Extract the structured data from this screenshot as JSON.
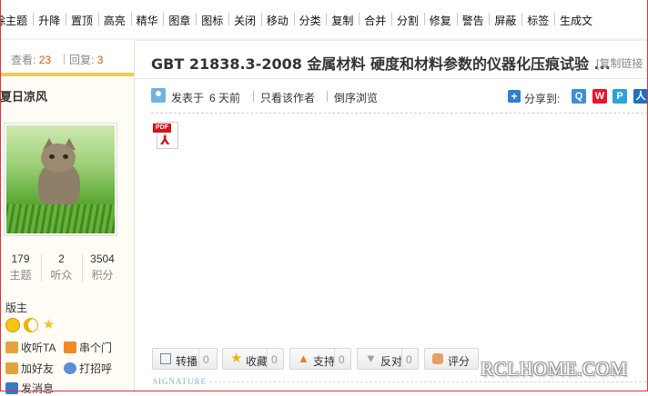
{
  "toolbar": {
    "items": [
      "除主题",
      "升降",
      "置顶",
      "高亮",
      "精华",
      "图章",
      "图标",
      "关闭",
      "移动",
      "分类",
      "复制",
      "合并",
      "分割",
      "修复",
      "警告",
      "屏蔽",
      "标签",
      "生成文"
    ]
  },
  "sidebar": {
    "views_label": "查看:",
    "views_count": "23",
    "replies_label": "回复:",
    "replies_count": "3",
    "username": "夏日凉风",
    "stats": [
      {
        "value": "179",
        "label": "主题"
      },
      {
        "value": "2",
        "label": "听众"
      },
      {
        "value": "3504",
        "label": "积分"
      }
    ],
    "role": "版主",
    "medal_colors": [
      "#f5c518",
      "#f0b400",
      "#f2c230"
    ],
    "actions": [
      {
        "label": "收听TA",
        "icon": "listen-icon",
        "color": "#e7a23a"
      },
      {
        "label": "串个门",
        "icon": "home-icon",
        "color": "#f08a24"
      },
      {
        "label": "加好友",
        "icon": "add-friend-icon",
        "color": "#e3a33c"
      },
      {
        "label": "打招呼",
        "icon": "greet-icon",
        "color": "#5c8fd6"
      },
      {
        "label": "发消息",
        "icon": "message-icon",
        "color": "#3b78c2"
      }
    ]
  },
  "thread": {
    "title": "GBT 21838.3-2008 金属材料 硬度和材料参数的仪器化压痕试验 ...",
    "copy_link": "[复制链接",
    "posted_prefix": "发表于",
    "posted_time": "6 天前",
    "only_author": "只看该作者",
    "reverse_order": "倒序浏览",
    "share_label": "分享到:",
    "share_icons": [
      {
        "name": "qzone-icon",
        "glyph": "Q",
        "color": "#3b8fd9"
      },
      {
        "name": "weibo-icon",
        "glyph": "W",
        "color": "#e6162d"
      },
      {
        "name": "tencent-weibo-icon",
        "glyph": "P",
        "color": "#2aa3d8"
      },
      {
        "name": "renren-icon",
        "glyph": "人",
        "color": "#1f6fc3"
      }
    ],
    "attachment_icon": "pdf-icon",
    "pdf_tag": "PDF"
  },
  "buttons": [
    {
      "label": "转播",
      "count": "0",
      "icon": "forward-icon",
      "color": "#6f86a8"
    },
    {
      "label": "收藏",
      "count": "0",
      "icon": "star-icon",
      "color": "#f2b01e"
    },
    {
      "label": "支持",
      "count": "0",
      "icon": "support-icon",
      "color": "#f07c16"
    },
    {
      "label": "反对",
      "count": "0",
      "icon": "oppose-icon",
      "color": "#9aa0a8"
    },
    {
      "label": "评分",
      "count": "",
      "icon": "rate-icon",
      "color": "#e8a060"
    }
  ],
  "signature_label": "SIGNATURE",
  "watermark": "RCLHOME.COM"
}
